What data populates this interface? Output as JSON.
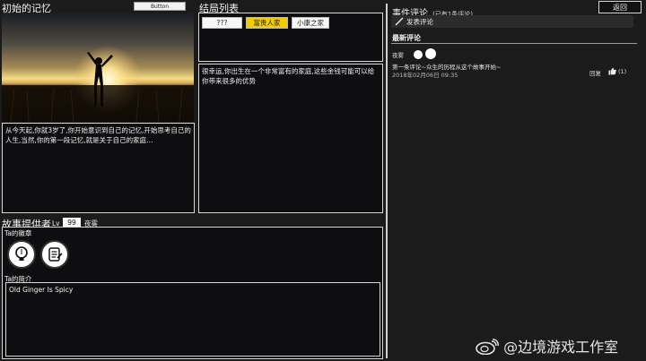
{
  "memory": {
    "title": "初始的记忆",
    "button_label": "Button",
    "text": "从今天起,你就3岁了,你开始意识到自己的记忆,开始思考自己的人生,当然,你的第一段记忆,就是关于自己的家庭…"
  },
  "endings": {
    "title": "结局列表",
    "items": [
      {
        "label": "???",
        "selected": false
      },
      {
        "label": "富贵人家",
        "selected": true
      },
      {
        "label": "小康之家",
        "selected": false
      }
    ],
    "description": "很幸运,你出生在一个非常富有的家庭,这些金钱可能可以给你带来很多的优势"
  },
  "provider": {
    "title": "故事提供者",
    "lv_label": "Lv",
    "level": "99",
    "name": "夜雾",
    "badges_title": "Ta的徽章",
    "badges": [
      "lightbulb-icon",
      "scroll-icon"
    ],
    "intro_title": "Ta的简介",
    "intro": "Old Ginger Is Spicy"
  },
  "comments": {
    "title": "事件评论",
    "count_text": "(已有1条评论)",
    "back_label": "返回",
    "post_label": "发表评论",
    "latest_title": "最新评论",
    "items": [
      {
        "author": "夜雾",
        "text": "第一条评论~众生的历程从这个故事开始~",
        "date": "2018年02月06日 09:35",
        "reply_label": "回复",
        "likes": "(1)"
      }
    ]
  },
  "colors": {
    "selected_bg": "#f2cc00",
    "panel_bg": "#0e0e10",
    "page_bg": "#1b1b1b"
  },
  "watermark": "@边境游戏工作室"
}
